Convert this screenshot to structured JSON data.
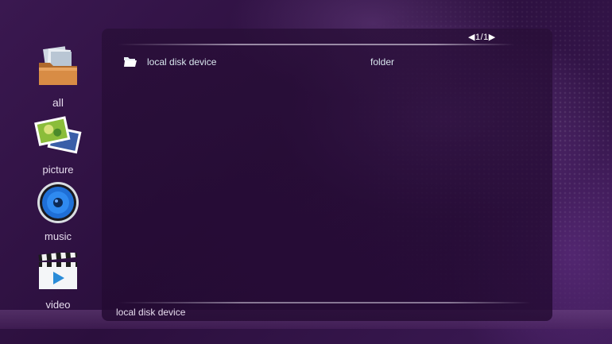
{
  "sidebar": {
    "items": [
      {
        "label": "all",
        "icon": "folder-documents-icon"
      },
      {
        "label": "picture",
        "icon": "photos-icon"
      },
      {
        "label": "music",
        "icon": "speaker-icon"
      },
      {
        "label": "video",
        "icon": "clapperboard-play-icon"
      }
    ]
  },
  "browser": {
    "pager": "◀1/1▶",
    "rows": [
      {
        "name": "local disk device",
        "type": "folder",
        "icon": "folder-open-icon"
      }
    ]
  },
  "status": {
    "path": "local disk device"
  },
  "colors": {
    "background": "#2b0f3d",
    "accent": "#1f6fd6",
    "text": "#d8e6ee"
  }
}
